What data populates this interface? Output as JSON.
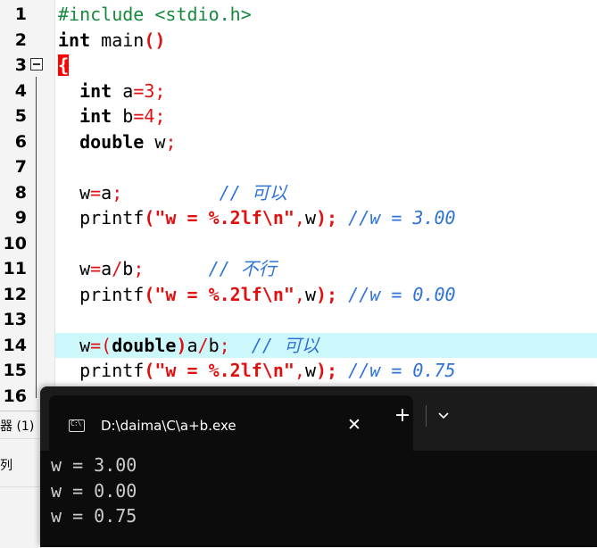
{
  "editor": {
    "lines": [
      {
        "num": "1",
        "segs": [
          {
            "t": "#include <stdio.h>",
            "c": "pp"
          }
        ]
      },
      {
        "num": "2",
        "segs": [
          {
            "t": "int",
            "c": "kw"
          },
          {
            "t": " main",
            "c": ""
          },
          {
            "t": "()",
            "c": "br"
          }
        ]
      },
      {
        "num": "3",
        "segs": [
          {
            "t": "{",
            "c": "br cursor-brace"
          }
        ]
      },
      {
        "num": "4",
        "segs": [
          {
            "t": "  ",
            "c": ""
          },
          {
            "t": "int",
            "c": "kw"
          },
          {
            "t": " a",
            "c": ""
          },
          {
            "t": "=",
            "c": "op"
          },
          {
            "t": "3",
            "c": "num"
          },
          {
            "t": ";",
            "c": "op"
          }
        ]
      },
      {
        "num": "5",
        "segs": [
          {
            "t": "  ",
            "c": ""
          },
          {
            "t": "int",
            "c": "kw"
          },
          {
            "t": " b",
            "c": ""
          },
          {
            "t": "=",
            "c": "op"
          },
          {
            "t": "4",
            "c": "num"
          },
          {
            "t": ";",
            "c": "op"
          }
        ]
      },
      {
        "num": "6",
        "segs": [
          {
            "t": "  ",
            "c": ""
          },
          {
            "t": "double",
            "c": "kw"
          },
          {
            "t": " w",
            "c": ""
          },
          {
            "t": ";",
            "c": "op"
          }
        ]
      },
      {
        "num": "7",
        "segs": []
      },
      {
        "num": "8",
        "segs": [
          {
            "t": "  w",
            "c": ""
          },
          {
            "t": "=",
            "c": "op"
          },
          {
            "t": "a",
            "c": ""
          },
          {
            "t": ";",
            "c": "op"
          },
          {
            "t": "         ",
            "c": ""
          },
          {
            "t": "// 可以",
            "c": "cm"
          }
        ]
      },
      {
        "num": "9",
        "segs": [
          {
            "t": "  printf",
            "c": ""
          },
          {
            "t": "(",
            "c": "br"
          },
          {
            "t": "\"w = %.2lf\\n\"",
            "c": "str"
          },
          {
            "t": ",",
            "c": "op"
          },
          {
            "t": "w",
            "c": ""
          },
          {
            "t": ");",
            "c": "br"
          },
          {
            "t": " ",
            "c": ""
          },
          {
            "t": "//w = 3.00",
            "c": "cm"
          }
        ]
      },
      {
        "num": "10",
        "segs": []
      },
      {
        "num": "11",
        "segs": [
          {
            "t": "  w",
            "c": ""
          },
          {
            "t": "=",
            "c": "op"
          },
          {
            "t": "a",
            "c": ""
          },
          {
            "t": "/",
            "c": "op"
          },
          {
            "t": "b",
            "c": ""
          },
          {
            "t": ";",
            "c": "op"
          },
          {
            "t": "      ",
            "c": ""
          },
          {
            "t": "// 不行",
            "c": "cm"
          }
        ]
      },
      {
        "num": "12",
        "segs": [
          {
            "t": "  printf",
            "c": ""
          },
          {
            "t": "(",
            "c": "br"
          },
          {
            "t": "\"w = %.2lf\\n\"",
            "c": "str"
          },
          {
            "t": ",",
            "c": "op"
          },
          {
            "t": "w",
            "c": ""
          },
          {
            "t": ");",
            "c": "br"
          },
          {
            "t": " ",
            "c": ""
          },
          {
            "t": "//w = 0.00",
            "c": "cm"
          }
        ]
      },
      {
        "num": "13",
        "segs": []
      },
      {
        "num": "14",
        "highlight": true,
        "segs": [
          {
            "t": "  w",
            "c": ""
          },
          {
            "t": "=(",
            "c": "op"
          },
          {
            "t": "double",
            "c": "kw"
          },
          {
            "t": ")",
            "c": "br"
          },
          {
            "t": "a",
            "c": ""
          },
          {
            "t": "/",
            "c": "op"
          },
          {
            "t": "b",
            "c": ""
          },
          {
            "t": ";",
            "c": "op"
          },
          {
            "t": "  ",
            "c": ""
          },
          {
            "t": "// 可以",
            "c": "cm"
          }
        ]
      },
      {
        "num": "15",
        "segs": [
          {
            "t": "  printf",
            "c": ""
          },
          {
            "t": "(",
            "c": "br"
          },
          {
            "t": "\"w = %.2lf\\n\"",
            "c": "str"
          },
          {
            "t": ",",
            "c": "op"
          },
          {
            "t": "w",
            "c": ""
          },
          {
            "t": ");",
            "c": "br"
          },
          {
            "t": " ",
            "c": ""
          },
          {
            "t": "//w = 0.75",
            "c": "cm"
          }
        ]
      },
      {
        "num": "16",
        "segs": []
      }
    ]
  },
  "side_panel": {
    "label": "器 (1)",
    "item": "列"
  },
  "terminal": {
    "icon_text": "C:\\",
    "tab_title": "D:\\daima\\C\\a+b.exe",
    "close_glyph": "✕",
    "new_tab_glyph": "+",
    "output": [
      "w = 3.00",
      "w = 0.00",
      "w = 0.75"
    ]
  },
  "colors": {
    "keyword": "#000000",
    "preprocessor": "#148a3c",
    "string": "#e01010",
    "comment": "#2f73d8",
    "highlight_line": "#cdf8fb",
    "terminal_bg": "#0c0c0c",
    "terminal_text": "#cccccc"
  }
}
